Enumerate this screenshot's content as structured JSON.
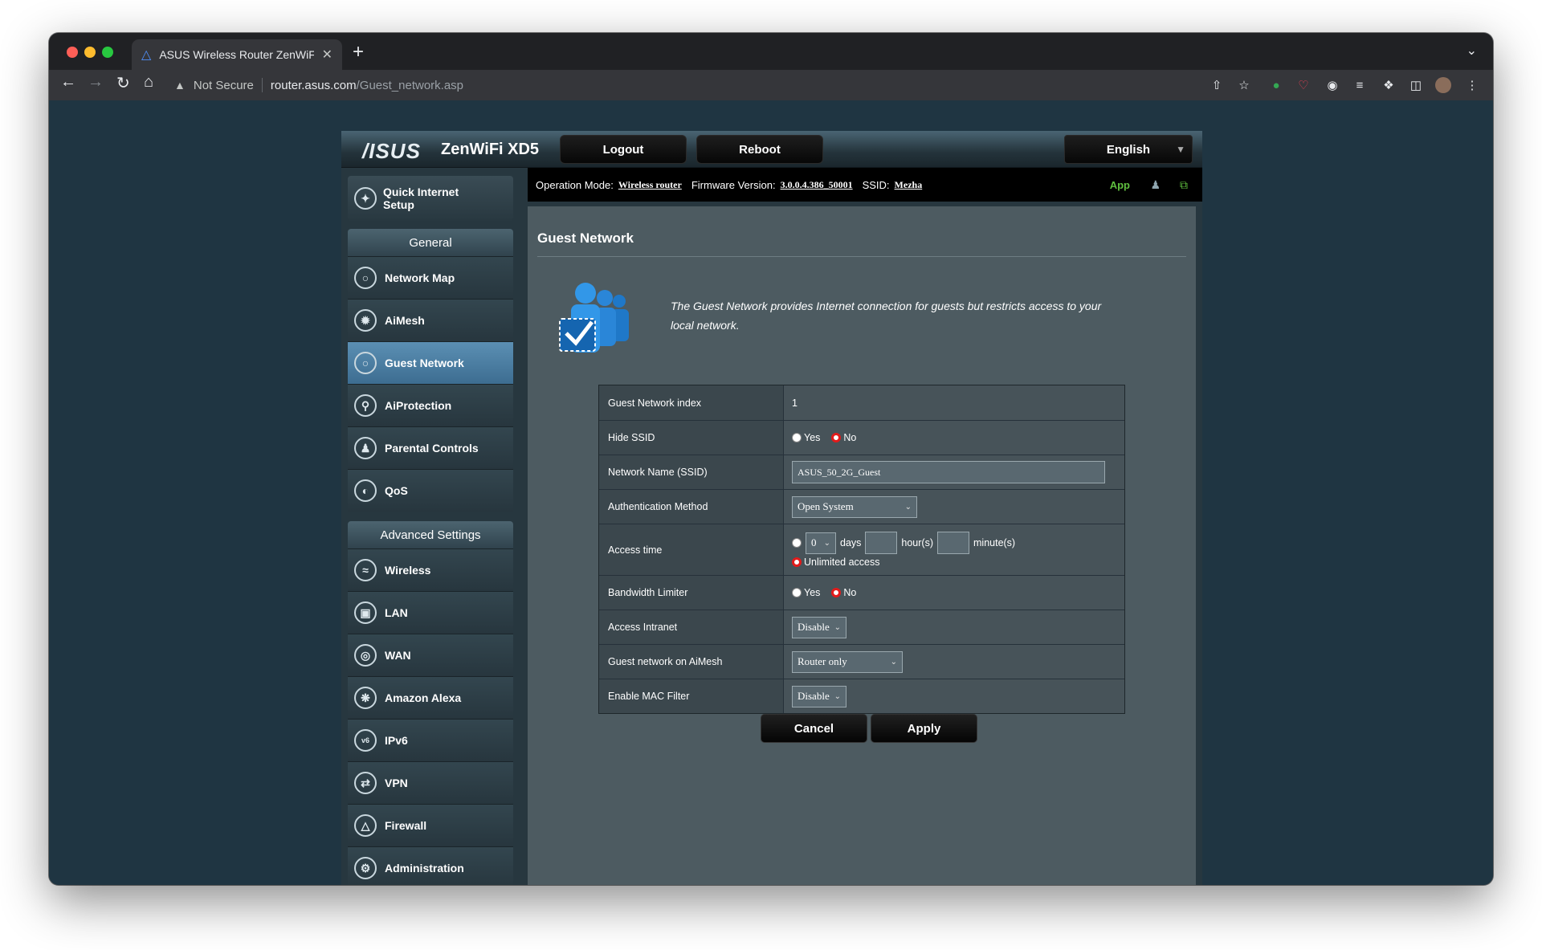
{
  "browser": {
    "tab_title": "ASUS Wireless Router ZenWiFi XD5",
    "security_label": "Not Secure",
    "url_host": "router.asus.com",
    "url_path": "/Guest_network.asp"
  },
  "router": {
    "logo": "/ISUS",
    "model": "ZenWiFi XD5",
    "logout": "Logout",
    "reboot": "Reboot",
    "language": "English",
    "status": {
      "op_mode_label": "Operation Mode:",
      "op_mode_value": "Wireless router",
      "fw_label": "Firmware Version:",
      "fw_value": "3.0.0.4.386_50001",
      "ssid_label": "SSID:",
      "ssid_value": "Mezha",
      "app": "App"
    }
  },
  "sidebar": {
    "quick_setup": "Quick Internet Setup",
    "general_header": "General",
    "general_items": [
      {
        "label": "Network Map",
        "icon": "globe-icon"
      },
      {
        "label": "AiMesh",
        "icon": "mesh-icon"
      },
      {
        "label": "Guest Network",
        "icon": "guest-icon"
      },
      {
        "label": "AiProtection",
        "icon": "lock-icon"
      },
      {
        "label": "Parental Controls",
        "icon": "family-icon"
      },
      {
        "label": "QoS",
        "icon": "gauge-icon"
      }
    ],
    "advanced_header": "Advanced Settings",
    "advanced_items": [
      {
        "label": "Wireless",
        "icon": "wifi-icon"
      },
      {
        "label": "LAN",
        "icon": "monitor-icon"
      },
      {
        "label": "WAN",
        "icon": "globe-icon"
      },
      {
        "label": "Amazon Alexa",
        "icon": "alexa-icon"
      },
      {
        "label": "IPv6",
        "icon": "ipv6-icon"
      },
      {
        "label": "VPN",
        "icon": "vpn-icon"
      },
      {
        "label": "Firewall",
        "icon": "fire-icon"
      },
      {
        "label": "Administration",
        "icon": "gear-icon"
      }
    ]
  },
  "panel": {
    "title": "Guest Network",
    "description": "The Guest Network provides Internet connection for guests but restricts access to your local network.",
    "fields": {
      "index_label": "Guest Network index",
      "index_value": "1",
      "hide_ssid_label": "Hide SSID",
      "yes": "Yes",
      "no": "No",
      "ssid_label": "Network Name (SSID)",
      "ssid_value": "ASUS_50_2G_Guest",
      "auth_label": "Authentication Method",
      "auth_value": "Open System",
      "access_time_label": "Access time",
      "days_value": "0",
      "days": "days",
      "hours": "hour(s)",
      "minutes": "minute(s)",
      "unlimited": "Unlimited access",
      "bw_label": "Bandwidth Limiter",
      "intranet_label": "Access Intranet",
      "intranet_value": "Disable",
      "aimesh_label": "Guest network on AiMesh",
      "aimesh_value": "Router only",
      "mac_label": "Enable MAC Filter",
      "mac_value": "Disable"
    },
    "cancel": "Cancel",
    "apply": "Apply"
  }
}
